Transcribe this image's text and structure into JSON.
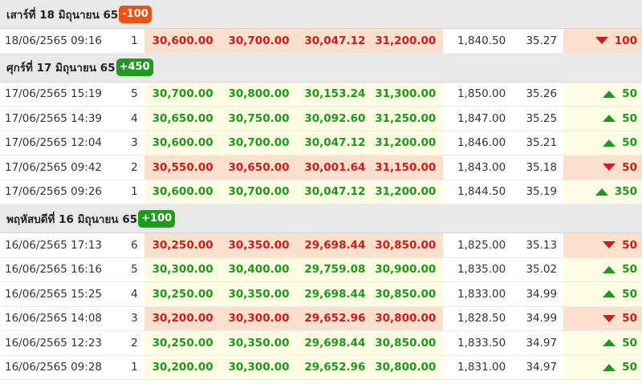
{
  "colors": {
    "up": "#1a9a1a",
    "down": "#d11a1a",
    "badge_up": "#1f9a1f",
    "badge_down": "#f05010",
    "bg_up": "#fcfde2",
    "bg_down": "#fbe1cd"
  },
  "days": [
    {
      "title": "เสาร์ที่ 18 มิถุนายน 65",
      "badge": "-100",
      "direction": "down",
      "rows": [
        {
          "time": "18/06/2565 09:16",
          "no": "1",
          "buy": "30,600.00",
          "sell": "30,700.00",
          "p3": "30,047.12",
          "p4": "31,200.00",
          "gold": "1,840.50",
          "rate": "35.27",
          "dir": "down",
          "change": "100"
        }
      ]
    },
    {
      "title": "ศุกร์ที่ 17 มิถุนายน 65",
      "badge": "+450",
      "direction": "up",
      "rows": [
        {
          "time": "17/06/2565 15:19",
          "no": "5",
          "buy": "30,700.00",
          "sell": "30,800.00",
          "p3": "30,153.24",
          "p4": "31,300.00",
          "gold": "1,850.00",
          "rate": "35.26",
          "dir": "up",
          "change": "50"
        },
        {
          "time": "17/06/2565 14:39",
          "no": "4",
          "buy": "30,650.00",
          "sell": "30,750.00",
          "p3": "30,092.60",
          "p4": "31,250.00",
          "gold": "1,847.00",
          "rate": "35.25",
          "dir": "up",
          "change": "50"
        },
        {
          "time": "17/06/2565 12:04",
          "no": "3",
          "buy": "30,600.00",
          "sell": "30,700.00",
          "p3": "30,047.12",
          "p4": "31,200.00",
          "gold": "1,846.00",
          "rate": "35.21",
          "dir": "up",
          "change": "50"
        },
        {
          "time": "17/06/2565 09:42",
          "no": "2",
          "buy": "30,550.00",
          "sell": "30,650.00",
          "p3": "30,001.64",
          "p4": "31,150.00",
          "gold": "1,843.00",
          "rate": "35.18",
          "dir": "down",
          "change": "50"
        },
        {
          "time": "17/06/2565 09:26",
          "no": "1",
          "buy": "30,600.00",
          "sell": "30,700.00",
          "p3": "30,047.12",
          "p4": "31,200.00",
          "gold": "1,844.50",
          "rate": "35.19",
          "dir": "up",
          "change": "350"
        }
      ]
    },
    {
      "title": "พฤหัสบดีที่ 16 มิถุนายน 65",
      "badge": "+100",
      "direction": "up",
      "rows": [
        {
          "time": "16/06/2565 17:13",
          "no": "6",
          "buy": "30,250.00",
          "sell": "30,350.00",
          "p3": "29,698.44",
          "p4": "30,850.00",
          "gold": "1,825.00",
          "rate": "35.13",
          "dir": "down",
          "change": "50"
        },
        {
          "time": "16/06/2565 16:16",
          "no": "5",
          "buy": "30,300.00",
          "sell": "30,400.00",
          "p3": "29,759.08",
          "p4": "30,900.00",
          "gold": "1,835.00",
          "rate": "35.02",
          "dir": "up",
          "change": "50"
        },
        {
          "time": "16/06/2565 15:25",
          "no": "4",
          "buy": "30,250.00",
          "sell": "30,350.00",
          "p3": "29,698.44",
          "p4": "30,850.00",
          "gold": "1,833.00",
          "rate": "34.99",
          "dir": "up",
          "change": "50"
        },
        {
          "time": "16/06/2565 14:08",
          "no": "3",
          "buy": "30,200.00",
          "sell": "30,300.00",
          "p3": "29,652.96",
          "p4": "30,800.00",
          "gold": "1,828.50",
          "rate": "34.99",
          "dir": "down",
          "change": "50"
        },
        {
          "time": "16/06/2565 12:23",
          "no": "2",
          "buy": "30,250.00",
          "sell": "30,350.00",
          "p3": "29,698.44",
          "p4": "30,850.00",
          "gold": "1,833.50",
          "rate": "34.97",
          "dir": "up",
          "change": "50"
        },
        {
          "time": "16/06/2565 09:28",
          "no": "1",
          "buy": "30,200.00",
          "sell": "30,300.00",
          "p3": "29,652.96",
          "p4": "30,800.00",
          "gold": "1,831.00",
          "rate": "34.97",
          "dir": "up",
          "change": "50"
        }
      ]
    }
  ]
}
